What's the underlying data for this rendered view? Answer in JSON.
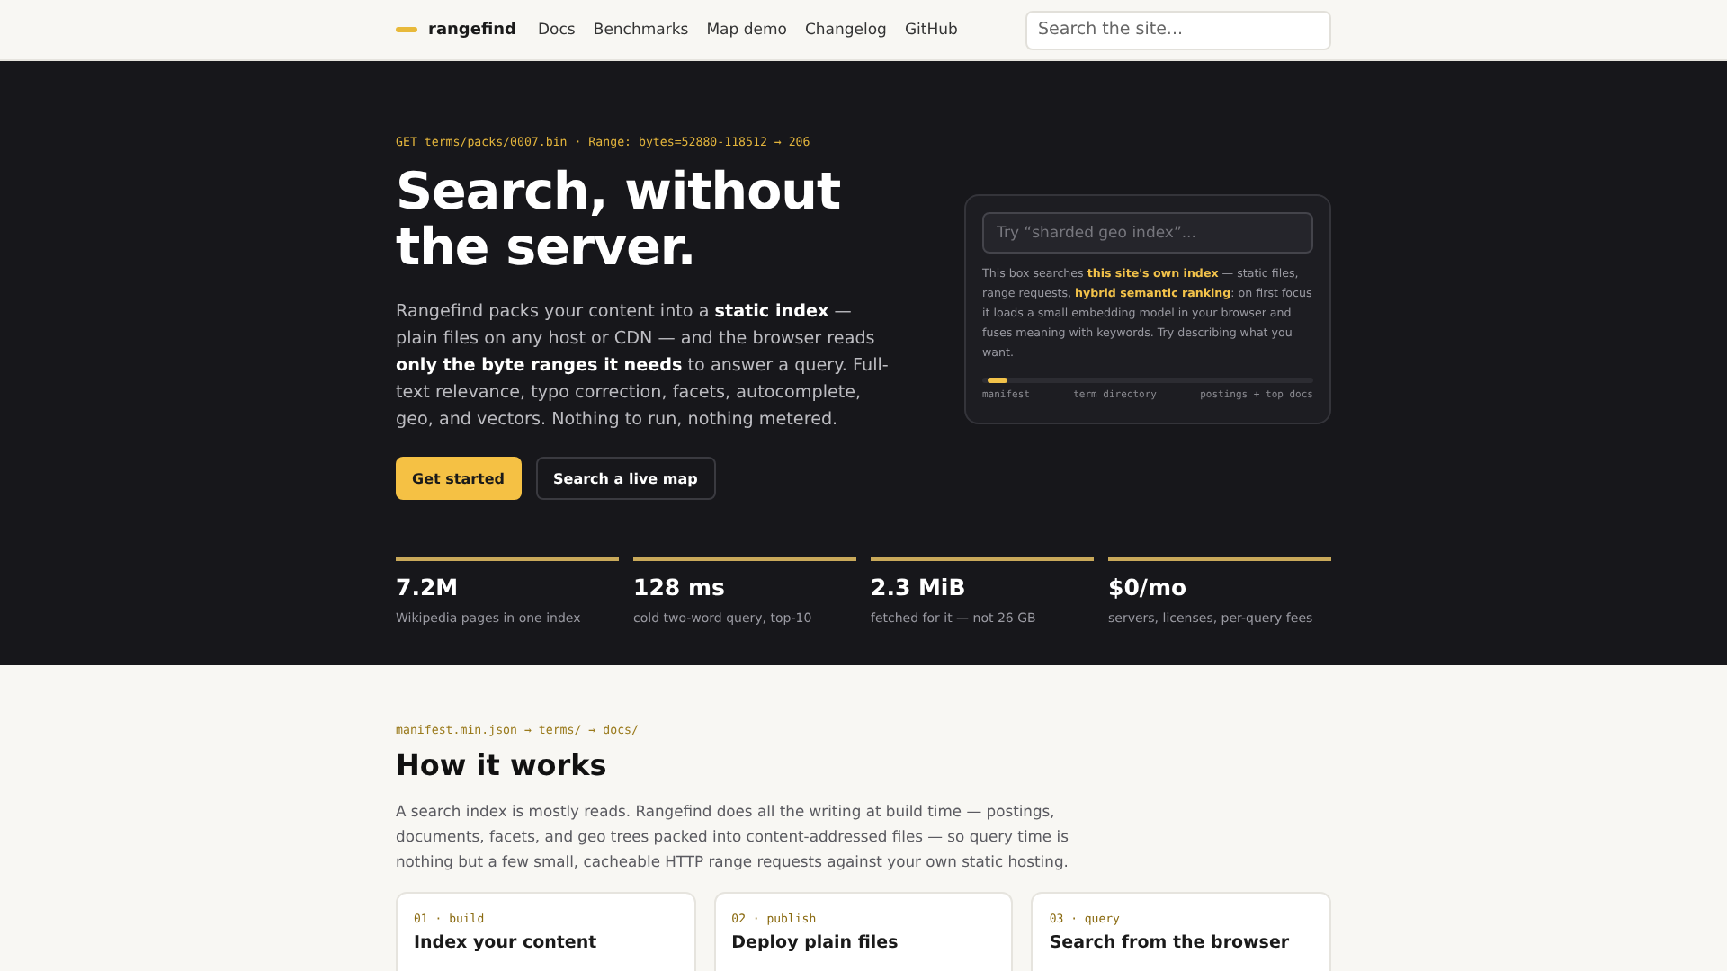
{
  "header": {
    "logo": "rangefind",
    "nav": [
      {
        "label": "Docs"
      },
      {
        "label": "Benchmarks"
      },
      {
        "label": "Map demo"
      },
      {
        "label": "Changelog"
      },
      {
        "label": "GitHub"
      }
    ],
    "search": {
      "placeholder": "Search the site..."
    }
  },
  "hero": {
    "eyebrow": "GET terms/packs/0007.bin · Range: bytes=52880-118512 → 206",
    "title_lines": [
      "Search, without",
      "the server."
    ],
    "body": "Rangefind packs your content into a **static index** — plain files on any host or CDN — and the browser reads **only the byte ranges it needs** to answer a query. Full-text relevance, typo correction, facets, autocomplete, geo, and vectors. Nothing to run, nothing metered.",
    "buttons": [
      {
        "label": "Get started",
        "kind": "primary"
      },
      {
        "label": "Search a live map",
        "kind": "secondary"
      }
    ],
    "demo": {
      "placeholder": "Try “sharded geo index”...",
      "description": "This box searches **this site's own index** — static files, range requests, **hybrid semantic ranking**: on first focus it loads a small embedding model in your browser and fuses meaning with keywords. Try describing what you want.",
      "progress": {
        "level": 0.06
      },
      "stages": [
        "manifest",
        "term directory",
        "postings + top docs"
      ]
    },
    "stats": [
      {
        "value": "7.2M",
        "label": "Wikipedia pages in one index"
      },
      {
        "value": "128 ms",
        "label": "cold two-word query, top-10"
      },
      {
        "value": "2.3 MiB",
        "label": "fetched for it — not 26 GB"
      },
      {
        "value": "$0/mo",
        "label": "servers, licenses, per-query fees"
      }
    ]
  },
  "how": {
    "eyebrow": "manifest.min.json → terms/ → docs/",
    "title": "How it works",
    "body": "A search index is mostly reads. Rangefind does all the writing at build time — postings, documents, facets, and geo trees packed into content-addressed files — so query time is nothing but a few small, cacheable HTTP range requests against your own static hosting.",
    "cards": [
      {
        "step": "01 · build",
        "title": "Index your content"
      },
      {
        "step": "02 · publish",
        "title": "Deploy plain files"
      },
      {
        "step": "03 · query",
        "title": "Search from the browser"
      }
    ]
  }
}
